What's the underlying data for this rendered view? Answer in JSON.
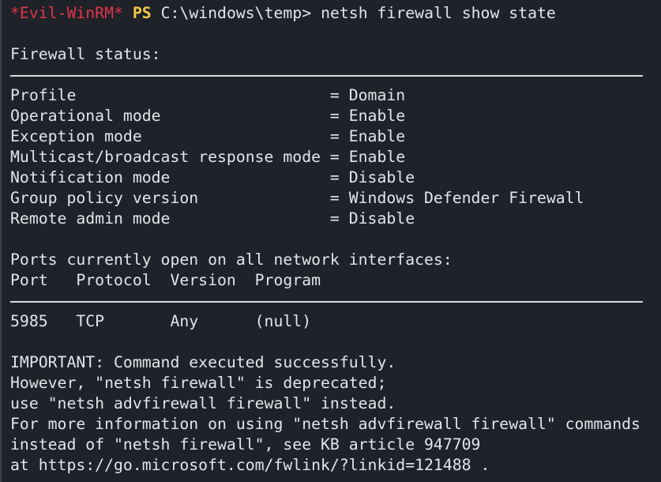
{
  "prompt": {
    "shell_name": "*Evil-WinRM*",
    "ps": "PS",
    "path": "C:\\windows\\temp>",
    "command": "netsh firewall show state"
  },
  "firewall_status": {
    "heading": "Firewall status:",
    "rows": [
      {
        "label": "Profile                           ",
        "value": "= Domain"
      },
      {
        "label": "Operational mode                  ",
        "value": "= Enable"
      },
      {
        "label": "Exception mode                    ",
        "value": "= Enable"
      },
      {
        "label": "Multicast/broadcast response mode ",
        "value": "= Enable"
      },
      {
        "label": "Notification mode                 ",
        "value": "= Disable"
      },
      {
        "label": "Group policy version              ",
        "value": "= Windows Defender Firewall"
      },
      {
        "label": "Remote admin mode                 ",
        "value": "= Disable"
      }
    ]
  },
  "ports": {
    "heading": "Ports currently open on all network interfaces:",
    "header": "Port   Protocol  Version  Program",
    "rows": [
      "5985   TCP       Any      (null)"
    ]
  },
  "notice": {
    "lines": [
      "IMPORTANT: Command executed successfully.",
      "However, \"netsh firewall\" is deprecated;",
      "use \"netsh advfirewall firewall\" instead.",
      "For more information on using \"netsh advfirewall firewall\" commands",
      "instead of \"netsh firewall\", see KB article 947709",
      "at https://go.microsoft.com/fwlink/?linkid=121488 ."
    ]
  },
  "colors": {
    "background": "#1f2228",
    "text": "#e3e5e8",
    "shell_name": "#e0364a",
    "ps": "#f2c94c"
  }
}
